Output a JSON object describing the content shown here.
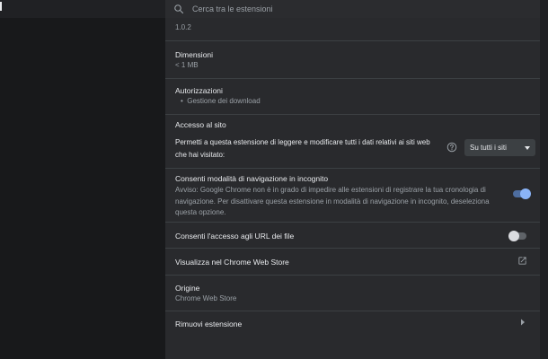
{
  "search": {
    "placeholder": "Cerca tra le estensioni"
  },
  "version": {
    "value": "1.0.2"
  },
  "size": {
    "title": "Dimensioni",
    "value": "< 1 MB"
  },
  "permissions": {
    "title": "Autorizzazioni",
    "items": [
      "Gestione dei download"
    ]
  },
  "site_access": {
    "title": "Accesso al sito",
    "description_line1": "Permetti a questa estensione di leggere e modificare tutti i dati relativi ai siti web",
    "description_line2": "che hai visitato:",
    "select_value": "Su tutti i siti"
  },
  "incognito": {
    "title": "Consenti modalità di navigazione in incognito",
    "warning_line1": "Avviso: Google Chrome non è in grado di impedire alle estensioni di registrare la tua cronologia di",
    "warning_line2": "navigazione. Per disattivare questa estensione in modalità di navigazione in incognito, deseleziona",
    "warning_line3": "questa opzione.",
    "enabled": true
  },
  "file_urls": {
    "title": "Consenti l'accesso agli URL dei file",
    "enabled": false
  },
  "webstore": {
    "title": "Visualizza nel Chrome Web Store"
  },
  "origin": {
    "title": "Origine",
    "value": "Chrome Web Store"
  },
  "remove": {
    "title": "Rimuovi estensione"
  },
  "colors": {
    "background": "#202124",
    "panel": "#292a2d",
    "accent": "#8ab4f8",
    "divider": "#3c4043"
  }
}
